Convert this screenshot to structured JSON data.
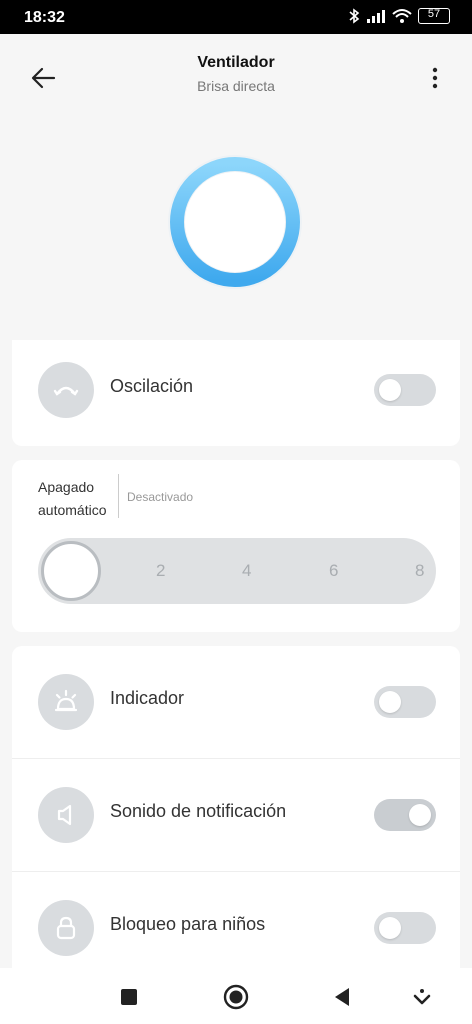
{
  "status_bar": {
    "time": "18:32",
    "battery": "57"
  },
  "header": {
    "title": "Ventilador",
    "subtitle": "Brisa directa"
  },
  "oscillation": {
    "label": "Oscilación",
    "enabled": false
  },
  "auto_off": {
    "label_line1": "Apagado",
    "label_line2": "automático",
    "status": "Desactivado",
    "ticks": [
      "2",
      "4",
      "6",
      "8"
    ],
    "value": 0
  },
  "settings": [
    {
      "label": "Indicador",
      "enabled": false
    },
    {
      "label": "Sonido de notificación",
      "enabled": true
    },
    {
      "label": "Bloqueo para niños",
      "enabled": false
    }
  ],
  "colors": {
    "accent": "#4fb4f0",
    "ring_light": "#8dd6fb"
  }
}
